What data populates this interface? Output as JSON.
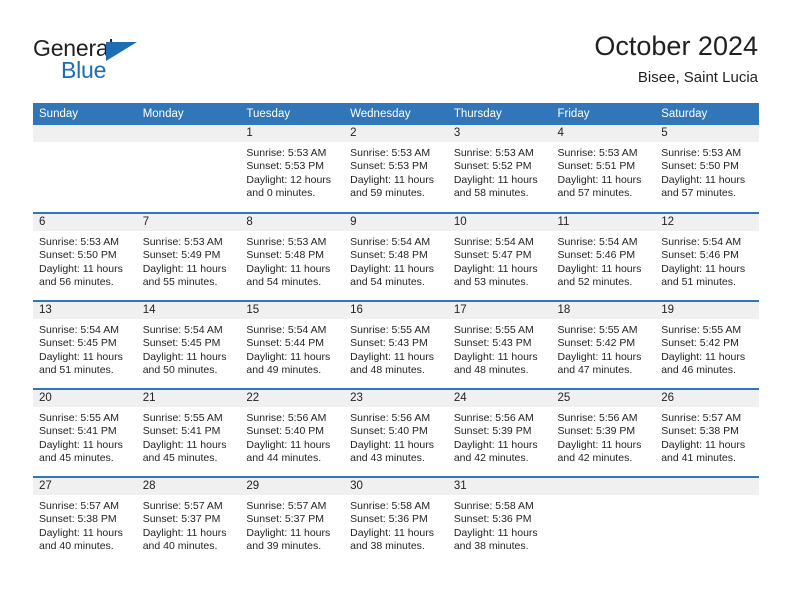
{
  "logo": {
    "word_one": "General",
    "word_two": "Blue",
    "triangle_color": "#1d6cb4"
  },
  "header": {
    "title": "October 2024",
    "subtitle": "Bisee, Saint Lucia"
  },
  "theme": {
    "header_blue": "#3176b8",
    "daynum_band": "#f0f0f0",
    "text": "#231f20"
  },
  "weekdays": [
    "Sunday",
    "Monday",
    "Tuesday",
    "Wednesday",
    "Thursday",
    "Friday",
    "Saturday"
  ],
  "weeks": [
    [
      {
        "day": "",
        "sunrise": "",
        "sunset": "",
        "daylight_line1": "",
        "daylight_line2": ""
      },
      {
        "day": "",
        "sunrise": "",
        "sunset": "",
        "daylight_line1": "",
        "daylight_line2": ""
      },
      {
        "day": "1",
        "sunrise": "Sunrise: 5:53 AM",
        "sunset": "Sunset: 5:53 PM",
        "daylight_line1": "Daylight: 12 hours",
        "daylight_line2": "and 0 minutes."
      },
      {
        "day": "2",
        "sunrise": "Sunrise: 5:53 AM",
        "sunset": "Sunset: 5:53 PM",
        "daylight_line1": "Daylight: 11 hours",
        "daylight_line2": "and 59 minutes."
      },
      {
        "day": "3",
        "sunrise": "Sunrise: 5:53 AM",
        "sunset": "Sunset: 5:52 PM",
        "daylight_line1": "Daylight: 11 hours",
        "daylight_line2": "and 58 minutes."
      },
      {
        "day": "4",
        "sunrise": "Sunrise: 5:53 AM",
        "sunset": "Sunset: 5:51 PM",
        "daylight_line1": "Daylight: 11 hours",
        "daylight_line2": "and 57 minutes."
      },
      {
        "day": "5",
        "sunrise": "Sunrise: 5:53 AM",
        "sunset": "Sunset: 5:50 PM",
        "daylight_line1": "Daylight: 11 hours",
        "daylight_line2": "and 57 minutes."
      }
    ],
    [
      {
        "day": "6",
        "sunrise": "Sunrise: 5:53 AM",
        "sunset": "Sunset: 5:50 PM",
        "daylight_line1": "Daylight: 11 hours",
        "daylight_line2": "and 56 minutes."
      },
      {
        "day": "7",
        "sunrise": "Sunrise: 5:53 AM",
        "sunset": "Sunset: 5:49 PM",
        "daylight_line1": "Daylight: 11 hours",
        "daylight_line2": "and 55 minutes."
      },
      {
        "day": "8",
        "sunrise": "Sunrise: 5:53 AM",
        "sunset": "Sunset: 5:48 PM",
        "daylight_line1": "Daylight: 11 hours",
        "daylight_line2": "and 54 minutes."
      },
      {
        "day": "9",
        "sunrise": "Sunrise: 5:54 AM",
        "sunset": "Sunset: 5:48 PM",
        "daylight_line1": "Daylight: 11 hours",
        "daylight_line2": "and 54 minutes."
      },
      {
        "day": "10",
        "sunrise": "Sunrise: 5:54 AM",
        "sunset": "Sunset: 5:47 PM",
        "daylight_line1": "Daylight: 11 hours",
        "daylight_line2": "and 53 minutes."
      },
      {
        "day": "11",
        "sunrise": "Sunrise: 5:54 AM",
        "sunset": "Sunset: 5:46 PM",
        "daylight_line1": "Daylight: 11 hours",
        "daylight_line2": "and 52 minutes."
      },
      {
        "day": "12",
        "sunrise": "Sunrise: 5:54 AM",
        "sunset": "Sunset: 5:46 PM",
        "daylight_line1": "Daylight: 11 hours",
        "daylight_line2": "and 51 minutes."
      }
    ],
    [
      {
        "day": "13",
        "sunrise": "Sunrise: 5:54 AM",
        "sunset": "Sunset: 5:45 PM",
        "daylight_line1": "Daylight: 11 hours",
        "daylight_line2": "and 51 minutes."
      },
      {
        "day": "14",
        "sunrise": "Sunrise: 5:54 AM",
        "sunset": "Sunset: 5:45 PM",
        "daylight_line1": "Daylight: 11 hours",
        "daylight_line2": "and 50 minutes."
      },
      {
        "day": "15",
        "sunrise": "Sunrise: 5:54 AM",
        "sunset": "Sunset: 5:44 PM",
        "daylight_line1": "Daylight: 11 hours",
        "daylight_line2": "and 49 minutes."
      },
      {
        "day": "16",
        "sunrise": "Sunrise: 5:55 AM",
        "sunset": "Sunset: 5:43 PM",
        "daylight_line1": "Daylight: 11 hours",
        "daylight_line2": "and 48 minutes."
      },
      {
        "day": "17",
        "sunrise": "Sunrise: 5:55 AM",
        "sunset": "Sunset: 5:43 PM",
        "daylight_line1": "Daylight: 11 hours",
        "daylight_line2": "and 48 minutes."
      },
      {
        "day": "18",
        "sunrise": "Sunrise: 5:55 AM",
        "sunset": "Sunset: 5:42 PM",
        "daylight_line1": "Daylight: 11 hours",
        "daylight_line2": "and 47 minutes."
      },
      {
        "day": "19",
        "sunrise": "Sunrise: 5:55 AM",
        "sunset": "Sunset: 5:42 PM",
        "daylight_line1": "Daylight: 11 hours",
        "daylight_line2": "and 46 minutes."
      }
    ],
    [
      {
        "day": "20",
        "sunrise": "Sunrise: 5:55 AM",
        "sunset": "Sunset: 5:41 PM",
        "daylight_line1": "Daylight: 11 hours",
        "daylight_line2": "and 45 minutes."
      },
      {
        "day": "21",
        "sunrise": "Sunrise: 5:55 AM",
        "sunset": "Sunset: 5:41 PM",
        "daylight_line1": "Daylight: 11 hours",
        "daylight_line2": "and 45 minutes."
      },
      {
        "day": "22",
        "sunrise": "Sunrise: 5:56 AM",
        "sunset": "Sunset: 5:40 PM",
        "daylight_line1": "Daylight: 11 hours",
        "daylight_line2": "and 44 minutes."
      },
      {
        "day": "23",
        "sunrise": "Sunrise: 5:56 AM",
        "sunset": "Sunset: 5:40 PM",
        "daylight_line1": "Daylight: 11 hours",
        "daylight_line2": "and 43 minutes."
      },
      {
        "day": "24",
        "sunrise": "Sunrise: 5:56 AM",
        "sunset": "Sunset: 5:39 PM",
        "daylight_line1": "Daylight: 11 hours",
        "daylight_line2": "and 42 minutes."
      },
      {
        "day": "25",
        "sunrise": "Sunrise: 5:56 AM",
        "sunset": "Sunset: 5:39 PM",
        "daylight_line1": "Daylight: 11 hours",
        "daylight_line2": "and 42 minutes."
      },
      {
        "day": "26",
        "sunrise": "Sunrise: 5:57 AM",
        "sunset": "Sunset: 5:38 PM",
        "daylight_line1": "Daylight: 11 hours",
        "daylight_line2": "and 41 minutes."
      }
    ],
    [
      {
        "day": "27",
        "sunrise": "Sunrise: 5:57 AM",
        "sunset": "Sunset: 5:38 PM",
        "daylight_line1": "Daylight: 11 hours",
        "daylight_line2": "and 40 minutes."
      },
      {
        "day": "28",
        "sunrise": "Sunrise: 5:57 AM",
        "sunset": "Sunset: 5:37 PM",
        "daylight_line1": "Daylight: 11 hours",
        "daylight_line2": "and 40 minutes."
      },
      {
        "day": "29",
        "sunrise": "Sunrise: 5:57 AM",
        "sunset": "Sunset: 5:37 PM",
        "daylight_line1": "Daylight: 11 hours",
        "daylight_line2": "and 39 minutes."
      },
      {
        "day": "30",
        "sunrise": "Sunrise: 5:58 AM",
        "sunset": "Sunset: 5:36 PM",
        "daylight_line1": "Daylight: 11 hours",
        "daylight_line2": "and 38 minutes."
      },
      {
        "day": "31",
        "sunrise": "Sunrise: 5:58 AM",
        "sunset": "Sunset: 5:36 PM",
        "daylight_line1": "Daylight: 11 hours",
        "daylight_line2": "and 38 minutes."
      },
      {
        "day": "",
        "sunrise": "",
        "sunset": "",
        "daylight_line1": "",
        "daylight_line2": ""
      },
      {
        "day": "",
        "sunrise": "",
        "sunset": "",
        "daylight_line1": "",
        "daylight_line2": ""
      }
    ]
  ]
}
